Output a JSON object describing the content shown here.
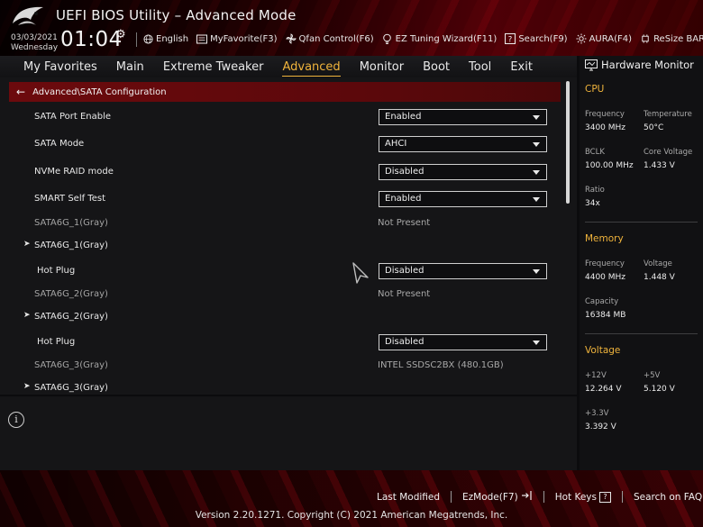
{
  "header": {
    "title": "UEFI BIOS Utility – Advanced Mode",
    "date": "03/03/2021",
    "weekday": "Wednesday",
    "time": "01:04",
    "toolbar": [
      {
        "label": "English",
        "icon": "globe-icon"
      },
      {
        "label": "MyFavorite(F3)",
        "icon": "favorite-icon"
      },
      {
        "label": "Qfan Control(F6)",
        "icon": "fan-icon"
      },
      {
        "label": "EZ Tuning Wizard(F11)",
        "icon": "bulb-icon"
      },
      {
        "label": "Search(F9)",
        "icon": "search-icon"
      },
      {
        "label": "AURA(F4)",
        "icon": "aura-icon"
      },
      {
        "label": "ReSize BAR",
        "icon": "resize-bar-icon"
      }
    ]
  },
  "nav": {
    "tabs": [
      "My Favorites",
      "Main",
      "Extreme Tweaker",
      "Advanced",
      "Monitor",
      "Boot",
      "Tool",
      "Exit"
    ],
    "active": "Advanced"
  },
  "breadcrumb": "Advanced\\SATA Configuration",
  "settings": [
    {
      "label": "SATA Port Enable",
      "kind": "select",
      "value": "Enabled"
    },
    {
      "label": "SATA Mode",
      "kind": "select",
      "value": "AHCI"
    },
    {
      "label": "NVMe RAID mode",
      "kind": "select",
      "value": "Disabled"
    },
    {
      "label": "SMART Self Test",
      "kind": "select",
      "value": "Enabled"
    },
    {
      "label": "SATA6G_1(Gray)",
      "kind": "info",
      "value": "Not Present"
    },
    {
      "label": "SATA6G_1(Gray)",
      "kind": "submenu"
    },
    {
      "label": "Hot Plug",
      "kind": "select-sub",
      "value": "Disabled"
    },
    {
      "label": "SATA6G_2(Gray)",
      "kind": "info",
      "value": "Not Present"
    },
    {
      "label": "SATA6G_2(Gray)",
      "kind": "submenu"
    },
    {
      "label": "Hot Plug",
      "kind": "select-sub",
      "value": "Disabled"
    },
    {
      "label": "SATA6G_3(Gray)",
      "kind": "info",
      "value": "INTEL SSDSC2BX (480.1GB)"
    },
    {
      "label": "SATA6G_3(Gray)",
      "kind": "submenu"
    }
  ],
  "hardware_monitor": {
    "title": "Hardware Monitor",
    "cpu": {
      "heading": "CPU",
      "frequency_label": "Frequency",
      "frequency": "3400 MHz",
      "temperature_label": "Temperature",
      "temperature": "50°C",
      "bclk_label": "BCLK",
      "bclk": "100.00 MHz",
      "core_voltage_label": "Core Voltage",
      "core_voltage": "1.433 V",
      "ratio_label": "Ratio",
      "ratio": "34x"
    },
    "memory": {
      "heading": "Memory",
      "frequency_label": "Frequency",
      "frequency": "4400 MHz",
      "voltage_label": "Voltage",
      "voltage": "1.448 V",
      "capacity_label": "Capacity",
      "capacity": "16384 MB"
    },
    "voltage": {
      "heading": "Voltage",
      "v12_label": "+12V",
      "v12": "12.264 V",
      "v5_label": "+5V",
      "v5": "5.120 V",
      "v33_label": "+3.3V",
      "v33": "3.392 V"
    }
  },
  "footer": {
    "last_modified": "Last Modified",
    "ezmode": "EzMode(F7)",
    "hot_keys": "Hot Keys",
    "hot_keys_key": "?",
    "search_faq": "Search on FAQ",
    "copyright": "Version 2.20.1271. Copyright (C) 2021 American Megatrends, Inc."
  },
  "colors": {
    "accent": "#f0b43c",
    "breadcrumb_bg": "#6c0a0d",
    "panel_bg": "#151517"
  }
}
